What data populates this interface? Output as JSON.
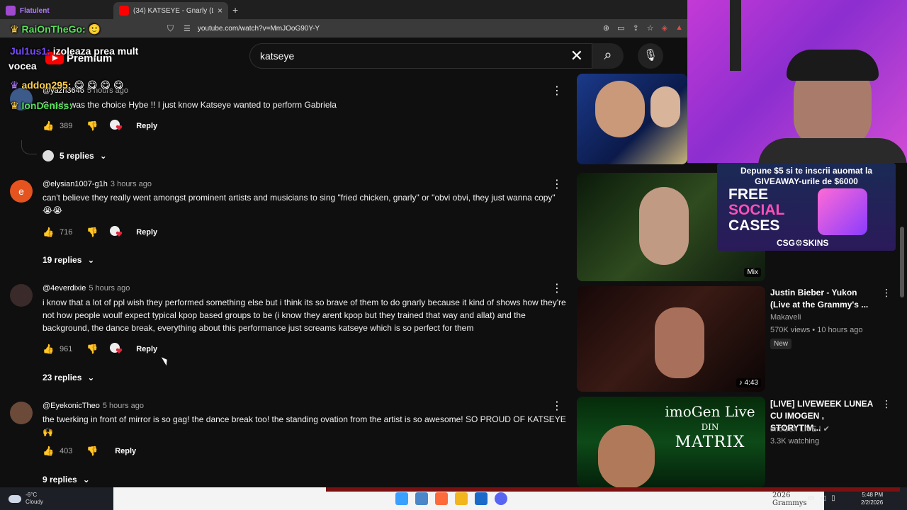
{
  "browser": {
    "tabs": [
      {
        "title": "Flatulent",
        "active": false
      },
      {
        "title": "(34) KATSEYE - Gnarly (Live fr",
        "active": true
      }
    ],
    "new_tab": "+",
    "close": "×",
    "url": "youtube.com/watch?v=MmJOoG90Y-Y"
  },
  "youtube": {
    "logo_text": "Premium",
    "search_query": "katseye",
    "comments": [
      {
        "author": "@yazri3646",
        "time": "5 hours ago",
        "text": "Gnarly was the choice Hybe !! I just know Katseye wanted to perform Gabriela",
        "likes": "389",
        "reply": "Reply",
        "replies": "5 replies"
      },
      {
        "author": "@elysian1007-g1h",
        "time": "3 hours ago",
        "text": "can't believe they really went amongst prominent artists and musicians to sing \"fried chicken, gnarly\" or \"obvi obvi, they just wanna copy\" 😭😭",
        "likes": "716",
        "reply": "Reply",
        "replies": "19 replies",
        "avatar_letter": "e"
      },
      {
        "author": "@4everdixie",
        "time": "5 hours ago",
        "text": "i know that a lot of ppl wish they performed something else but i think its so brave of them to do gnarly because it kind of shows how they're not how people woulf expect typical kpop based groups to be (i know they arent kpop but they trained that way and allat) and the background, the dance break, everything about this performance just screams katseye which is so perfect for them",
        "likes": "961",
        "reply": "Reply",
        "replies": "23 replies"
      },
      {
        "author": "@EyekonicTheo",
        "time": "5 hours ago",
        "text": "the twerking in front of mirror is so gag! the dance break too! the standing ovation from the artist is so awesome! SO PROUD OF KATSEYE 🙌",
        "likes": "403",
        "reply": "Reply",
        "replies": "9 replies"
      }
    ],
    "recommendations": [
      {
        "title": "Justin Bieber - Yukon (Live at the Grammy's ...",
        "channel": "Makaveli",
        "meta": "570K views • 10 hours ago",
        "badge": "New",
        "duration": "♪ 4:43"
      },
      {
        "title": "[LIVE]  LIVEWEEK LUNEA CU IMOGEN , STORYTIM...",
        "channel": "imoGen LIVE ! ✔",
        "meta": "3.3K watching",
        "thumb_text1": "imoGen Live",
        "thumb_text2": "DIN",
        "thumb_text3": "MATRIX"
      }
    ],
    "mix_label": "Mix"
  },
  "stream": {
    "ad_line1": "Depune $5 si te inscrii auomat la",
    "ad_line2": "GIVEAWAY-urile de $6000",
    "ad_free": "FREE",
    "ad_social": "SOCIAL",
    "ad_cases": "CASES",
    "ad_brand": "CSG⚙SKINS",
    "chat": [
      {
        "name": "RaiOnTheGo:",
        "msg": "🙂"
      },
      {
        "name": "Jul1us1:",
        "msg": "izoleaza prea mult"
      },
      {
        "name": "",
        "msg": "vocea"
      },
      {
        "name": "addon295:",
        "msg": "😋 😋 😋 😋"
      },
      {
        "name": "IonDeniss:",
        "msg": ""
      }
    ]
  },
  "taskbar": {
    "temp": "-6°C",
    "weather": "Cloudy",
    "time": "5:48 PM",
    "date": "2/2/2026",
    "center_text": "2026 Grammys"
  }
}
